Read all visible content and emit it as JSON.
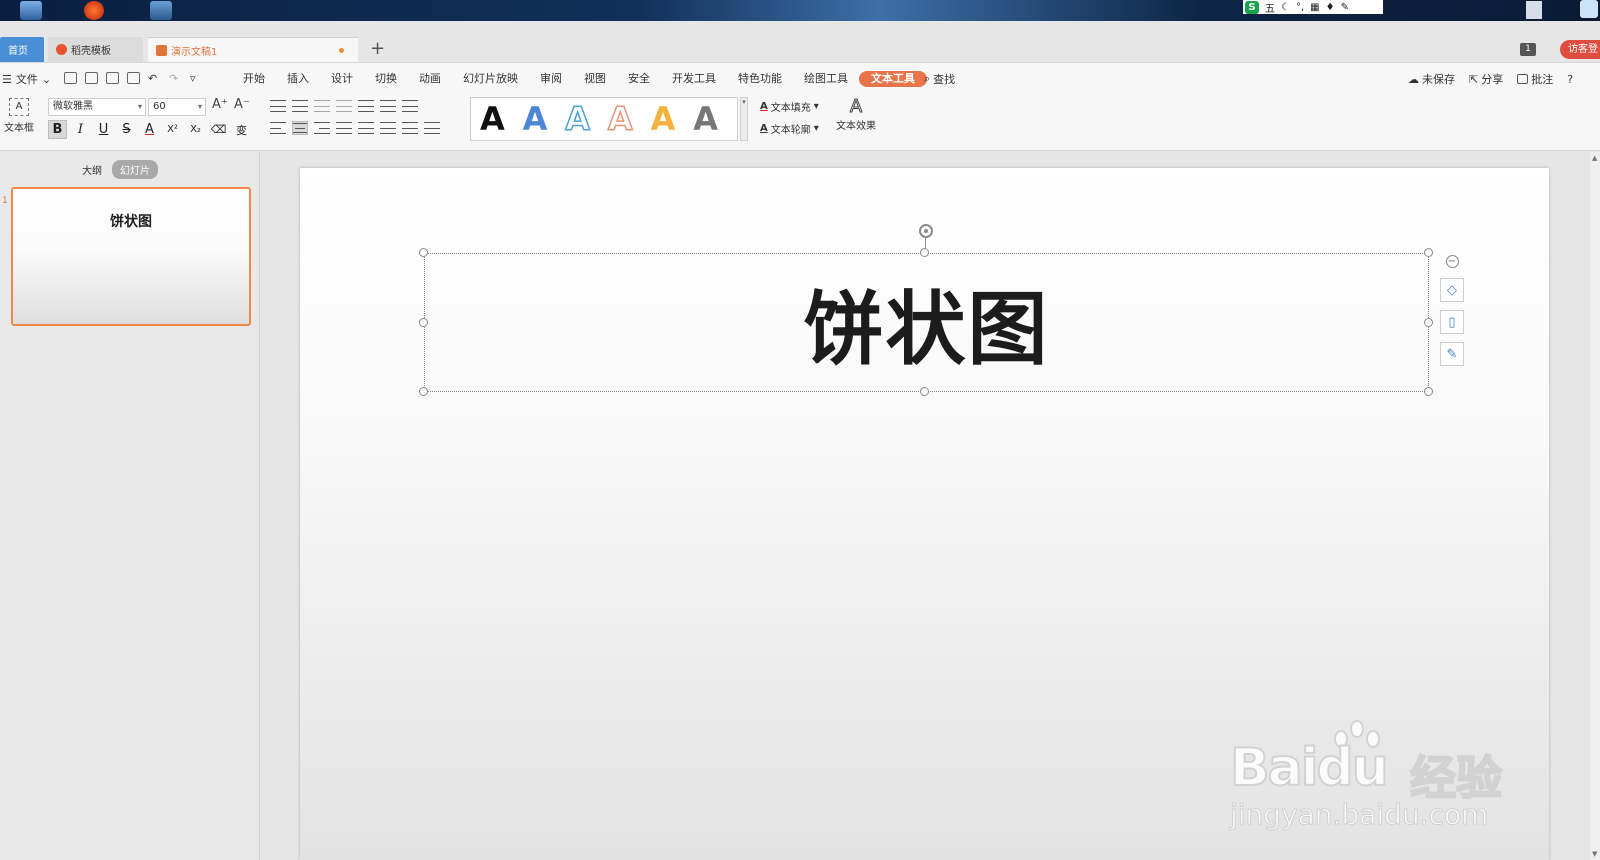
{
  "ime": {
    "logo": "S",
    "mode": "五"
  },
  "tabs": {
    "home": "首页",
    "docer": "稻壳模板",
    "doc": "演示文稿1",
    "add": "+",
    "window_count": "1",
    "login": "访客登"
  },
  "menu": {
    "file": "文件",
    "items": [
      "开始",
      "插入",
      "设计",
      "切换",
      "动画",
      "幻灯片放映",
      "审阅",
      "视图",
      "安全",
      "开发工具",
      "特色功能",
      "绘图工具",
      "文本工具"
    ],
    "active_index": 12,
    "search": "查找",
    "unsaved": "未保存",
    "share": "分享",
    "comment": "批注",
    "help": "?"
  },
  "ribbon": {
    "textbox_label": "文本框",
    "font_name": "微软雅黑",
    "font_size": "60",
    "grow": "A⁺",
    "shrink": "A⁻",
    "format": {
      "bold": "B",
      "italic": "I",
      "underline": "U",
      "strike": "S",
      "color": "A",
      "superscript": "X²",
      "subscript": "X₂",
      "eraser": "⌫",
      "phonetic": "变"
    },
    "styles": [
      "A",
      "A",
      "A",
      "A",
      "A",
      "A"
    ],
    "text_fill": "文本填充",
    "text_outline": "文本轮廓",
    "text_effect": "文本效果",
    "effect_icon": "A"
  },
  "panel": {
    "outline_tab": "大纲",
    "slides_tab": "幻灯片",
    "slide_number": "1",
    "thumb_title": "饼状图"
  },
  "slide": {
    "title": "饼状图"
  },
  "watermark": {
    "logo": "Baidu",
    "cn": "经验",
    "url": "jingyan.baidu.com"
  },
  "colors": {
    "accent": "#e8754a",
    "home_tab": "#4a8fd6",
    "login": "#e04d3f"
  }
}
